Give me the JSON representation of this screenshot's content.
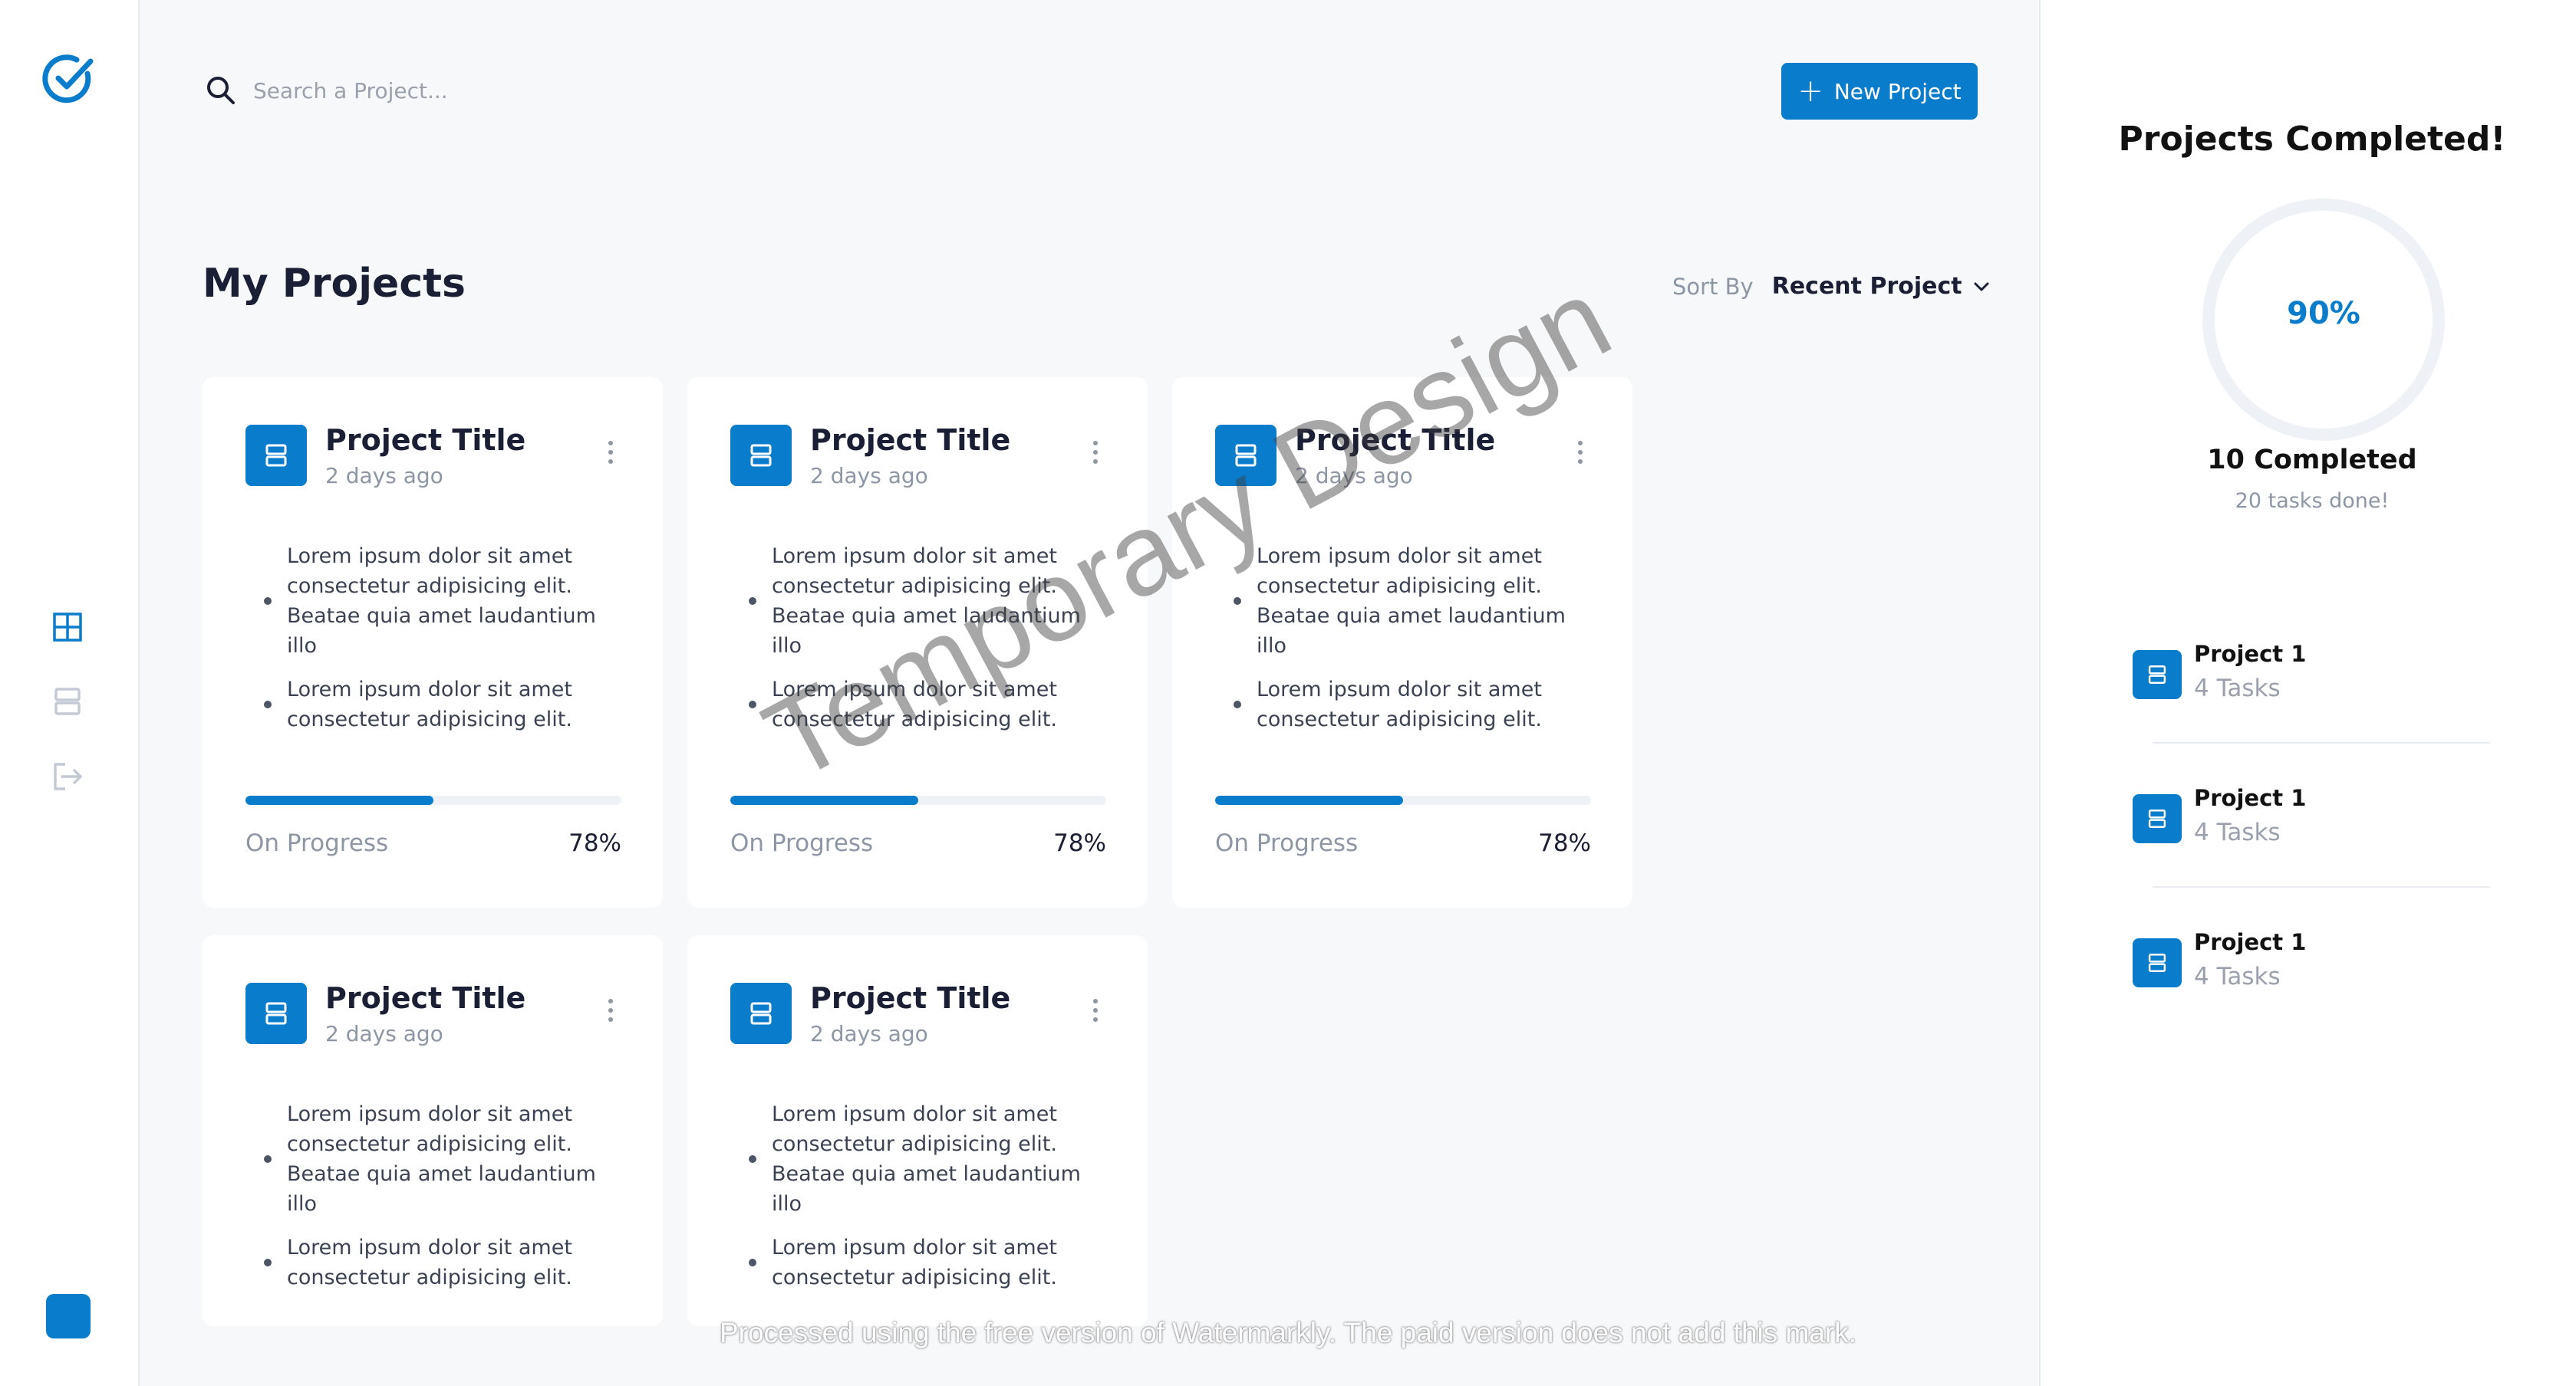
{
  "colors": {
    "accent": "#0a7ccc",
    "muted": "#8d96a5",
    "background": "#f7f8fa"
  },
  "sidebar": {
    "logo_icon": "check-circle-icon",
    "nav": [
      {
        "icon": "grid-icon",
        "active": true
      },
      {
        "icon": "layers-icon",
        "active": false
      },
      {
        "icon": "logout-icon",
        "active": false
      }
    ]
  },
  "header": {
    "search_placeholder": "Search a Project...",
    "new_button_label": "New Project"
  },
  "main": {
    "title": "My Projects",
    "sort_label": "Sort By",
    "sort_value": "Recent Project"
  },
  "projects": [
    {
      "title": "Project Title",
      "time": "2 days ago",
      "bullets": [
        "Lorem ipsum dolor sit amet consectetur adipisicing elit. Beatae quia amet laudantium illo",
        "Lorem ipsum dolor sit amet consectetur adipisicing elit."
      ],
      "status": "On Progress",
      "percent_label": "78%",
      "progress": 0.5
    },
    {
      "title": "Project Title",
      "time": "2 days ago",
      "bullets": [
        "Lorem ipsum dolor sit amet consectetur adipisicing elit. Beatae quia amet laudantium illo",
        "Lorem ipsum dolor sit amet consectetur adipisicing elit."
      ],
      "status": "On Progress",
      "percent_label": "78%",
      "progress": 0.5
    },
    {
      "title": "Project Title",
      "time": "2 days ago",
      "bullets": [
        "Lorem ipsum dolor sit amet consectetur adipisicing elit. Beatae quia amet laudantium illo",
        "Lorem ipsum dolor sit amet consectetur adipisicing elit."
      ],
      "status": "On Progress",
      "percent_label": "78%",
      "progress": 0.5
    },
    {
      "title": "Project Title",
      "time": "2 days ago",
      "bullets": [
        "Lorem ipsum dolor sit amet consectetur adipisicing elit. Beatae quia amet laudantium illo",
        "Lorem ipsum dolor sit amet consectetur adipisicing elit."
      ]
    },
    {
      "title": "Project Title",
      "time": "2 days ago",
      "bullets": [
        "Lorem ipsum dolor sit amet consectetur adipisicing elit. Beatae quia amet laudantium illo",
        "Lorem ipsum dolor sit amet consectetur adipisicing elit."
      ]
    }
  ],
  "summary": {
    "title": "Projects Completed!",
    "percent_label": "90%",
    "percent_value": 0.9,
    "completed": "10 Completed",
    "subtitle": "20 tasks done!",
    "items": [
      {
        "name": "Project 1",
        "tasks": "4 Tasks"
      },
      {
        "name": "Project 1",
        "tasks": "4 Tasks"
      },
      {
        "name": "Project 1",
        "tasks": "4 Tasks"
      }
    ]
  },
  "watermark_text": "Temporary Design",
  "footer_note": "Processed using the free version of Watermarkly. The paid version does not add this mark."
}
